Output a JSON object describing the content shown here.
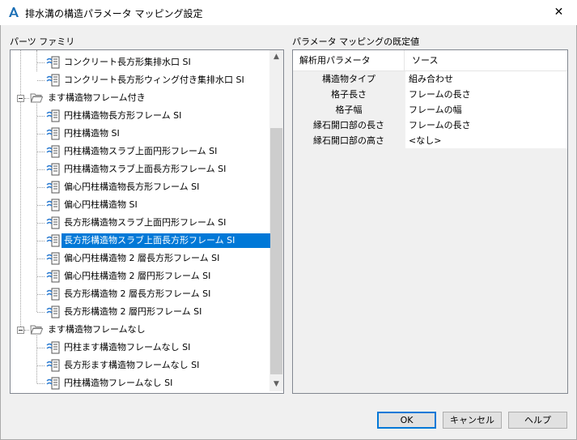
{
  "window": {
    "title": "排水溝の構造パラメータ マッピング設定",
    "close_glyph": "✕"
  },
  "left_panel": {
    "label": "パーツ ファミリ",
    "tree": [
      {
        "label": "コンクリート長方形集排水口 SI",
        "level": 2
      },
      {
        "label": "コンクリート長方形ウィング付き集排水口 SI",
        "level": 2
      },
      {
        "label": "ます構造物フレーム付き",
        "level": 1,
        "type": "folder",
        "expanded": true
      },
      {
        "label": "円柱構造物長方形フレーム SI",
        "level": 2
      },
      {
        "label": "円柱構造物 SI",
        "level": 2
      },
      {
        "label": "円柱構造物スラブ上面円形フレーム SI",
        "level": 2
      },
      {
        "label": "円柱構造物スラブ上面長方形フレーム SI",
        "level": 2
      },
      {
        "label": "偏心円柱構造物長方形フレーム SI",
        "level": 2
      },
      {
        "label": "偏心円柱構造物 SI",
        "level": 2
      },
      {
        "label": "長方形構造物スラブ上面円形フレーム SI",
        "level": 2
      },
      {
        "label": "長方形構造物スラブ上面長方形フレーム SI",
        "level": 2,
        "selected": true
      },
      {
        "label": "偏心円柱構造物 2 層長方形フレーム SI",
        "level": 2
      },
      {
        "label": "偏心円柱構造物 2 層円形フレーム SI",
        "level": 2
      },
      {
        "label": "長方形構造物 2 層長方形フレーム SI",
        "level": 2
      },
      {
        "label": "長方形構造物 2 層円形フレーム SI",
        "level": 2
      },
      {
        "label": "ます構造物フレームなし",
        "level": 1,
        "type": "folder",
        "expanded": true
      },
      {
        "label": "円柱ます構造物フレームなし SI",
        "level": 2
      },
      {
        "label": "長方形ます構造物フレームなし SI",
        "level": 2
      },
      {
        "label": "円柱構造物フレームなし SI",
        "level": 2
      }
    ]
  },
  "right_panel": {
    "label": "パラメータ マッピングの既定値",
    "headers": [
      "解析用パラメータ",
      "ソース"
    ],
    "rows": [
      {
        "param": "構造物タイプ",
        "source": "組み合わせ"
      },
      {
        "param": "格子長さ",
        "source": "フレームの長さ"
      },
      {
        "param": "格子幅",
        "source": "フレームの幅"
      },
      {
        "param": "縁石開口部の長さ",
        "source": "フレームの長さ"
      },
      {
        "param": "縁石開口部の高さ",
        "source": "<なし>"
      }
    ]
  },
  "buttons": {
    "ok": "OK",
    "cancel": "キャンセル",
    "help": "ヘルプ"
  },
  "scrollbar": {
    "up": "▲",
    "down": "▼",
    "position": 0.75
  },
  "colors": {
    "selection": "#0078d7",
    "accent_icon": "#2b7bd1"
  }
}
